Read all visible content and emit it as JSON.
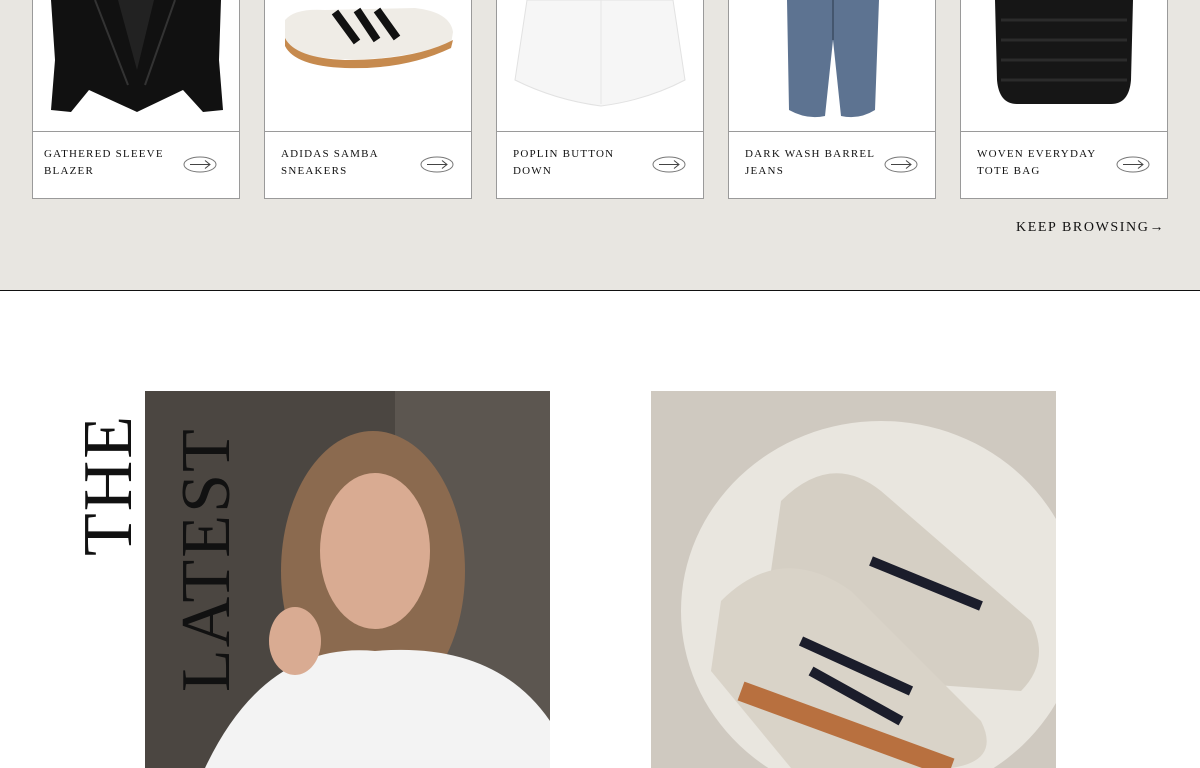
{
  "shop": {
    "products": [
      {
        "name": "GATHERED SLEEVE BLAZER"
      },
      {
        "name": "ADIDAS SAMBA SNEAKERS"
      },
      {
        "name": "POPLIN BUTTON DOWN"
      },
      {
        "name": "DARK WASH BARREL JEANS"
      },
      {
        "name": "WOVEN EVERYDAY TOTE BAG"
      }
    ],
    "keep_browsing": "KEEP BROWSING→"
  },
  "latest": {
    "word_1": "THE",
    "word_2": "LATEST"
  },
  "colors": {
    "band_background": "#e8e6e1",
    "text": "#111111"
  }
}
